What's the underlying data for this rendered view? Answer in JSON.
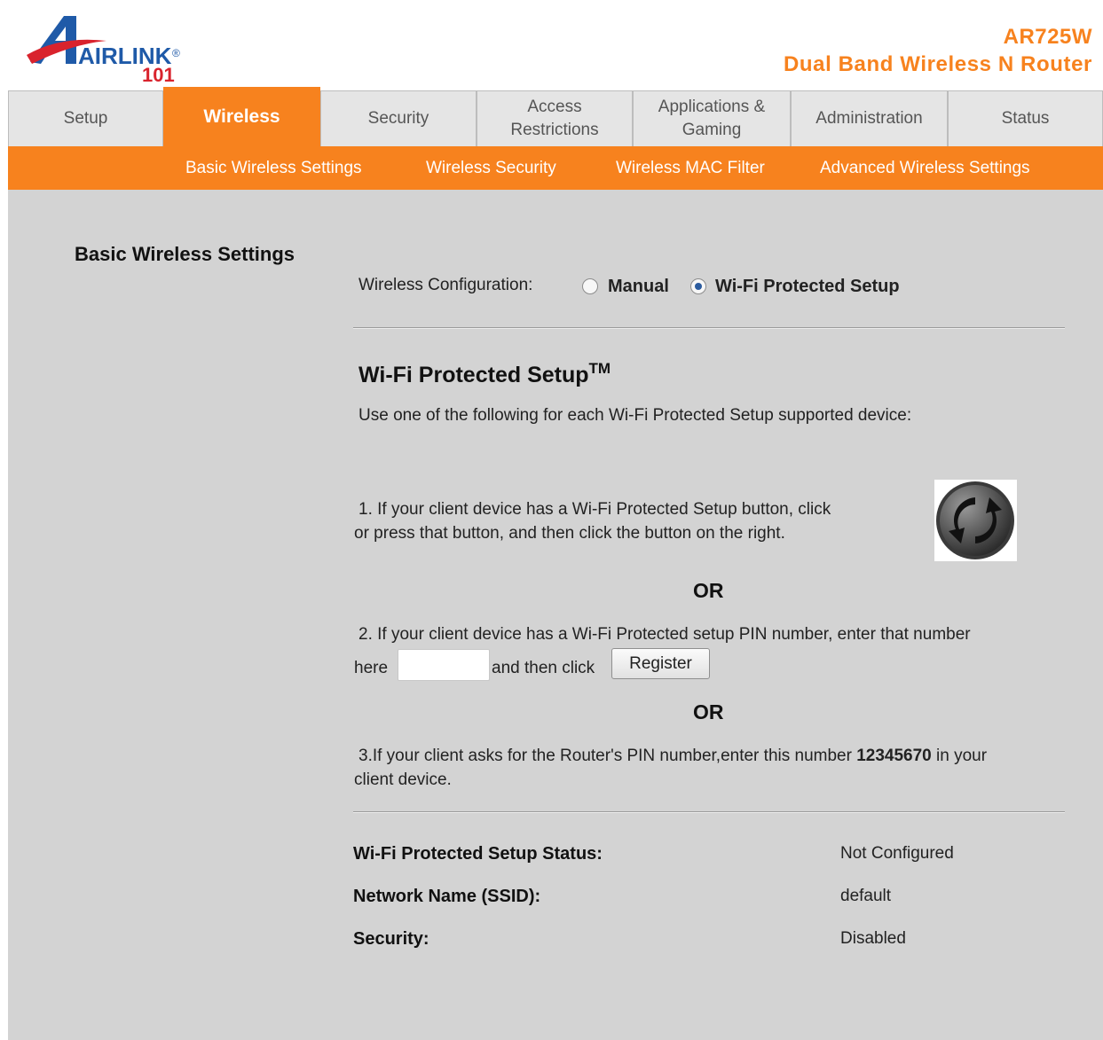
{
  "header": {
    "logo": {
      "text": "AIRLINK",
      "sub": "101",
      "mark": "®"
    },
    "model": "AR725W",
    "description": "Dual Band Wireless N Router"
  },
  "tabs": [
    {
      "label": "Setup",
      "active": false
    },
    {
      "label": "Wireless",
      "active": true
    },
    {
      "label": "Security",
      "active": false
    },
    {
      "label": "Access Restrictions",
      "active": false
    },
    {
      "label": "Applications & Gaming",
      "active": false
    },
    {
      "label": "Administration",
      "active": false
    },
    {
      "label": "Status",
      "active": false
    }
  ],
  "subnav": [
    "Basic Wireless Settings",
    "Wireless Security",
    "Wireless MAC Filter",
    "Advanced Wireless Settings"
  ],
  "page": {
    "section_title": "Basic Wireless Settings",
    "config_label": "Wireless Configuration:",
    "options": [
      {
        "label": "Manual",
        "selected": false
      },
      {
        "label": "Wi-Fi Protected Setup",
        "selected": true
      }
    ],
    "wps_heading": "Wi-Fi Protected Setup",
    "wps_tm": "TM",
    "intro": "Use one of the following for each Wi-Fi Protected Setup supported device:",
    "step1_line1": "1. If your client device has a Wi-Fi Protected Setup button, click",
    "step1_line2": "or press that button, and then click the button on the right.",
    "wps_button_icon": "wps-push-button-icon",
    "or": "OR",
    "step2_line1": "2. If your client device has a Wi-Fi Protected setup PIN number, enter that number",
    "step2_here": "here",
    "step2_then": "and then click",
    "pin_value": "",
    "register_label": "Register",
    "step3_pre": "3.If your client asks for the Router's PIN number,enter this number",
    "step3_pin": "12345670",
    "step3_post": "in your",
    "step3_line2": "client device.",
    "status": [
      {
        "label": "Wi-Fi Protected Setup Status:",
        "value": "Not Configured"
      },
      {
        "label": "Network Name (SSID):",
        "value": "default"
      },
      {
        "label": "Security:",
        "value": "Disabled"
      }
    ],
    "accent_color": "#f7821e",
    "logo_blue": "#1f5aa8",
    "logo_red": "#d9232d"
  }
}
